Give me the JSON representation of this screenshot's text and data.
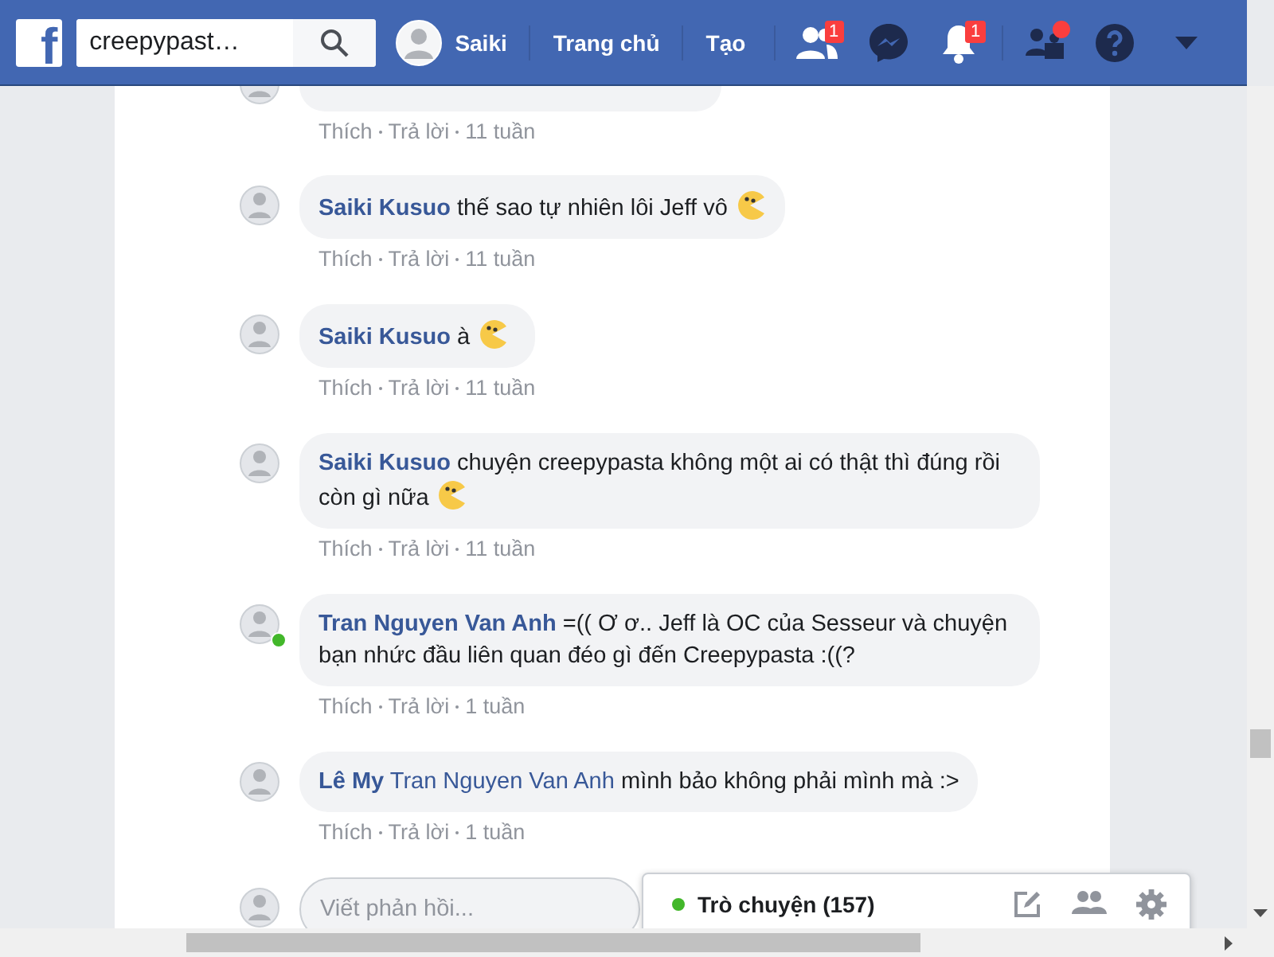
{
  "header": {
    "logo": "f",
    "search": {
      "value": "creepypast…"
    },
    "profile": {
      "name": "Saiki"
    },
    "nav": [
      "Trang chủ",
      "Tạo"
    ],
    "icons": [
      {
        "kind": "friends",
        "badge": "1"
      },
      {
        "kind": "messenger"
      },
      {
        "kind": "bell",
        "badge": "1"
      },
      {
        "kind": "people",
        "dot": true
      },
      {
        "kind": "help"
      },
      {
        "kind": "caret"
      }
    ]
  },
  "comments": [
    {
      "partial": true,
      "meta": {
        "like": "Thích",
        "reply": "Trả lời",
        "time": "11 tuần"
      }
    },
    {
      "author": "Saiki Kusuo",
      "text": "thế sao tự nhiên lôi Jeff vô",
      "emoji": true,
      "online": false,
      "meta": {
        "like": "Thích",
        "reply": "Trả lời",
        "time": "11 tuần"
      }
    },
    {
      "author": "Saiki Kusuo",
      "text": "à",
      "emoji": true,
      "online": false,
      "meta": {
        "like": "Thích",
        "reply": "Trả lời",
        "time": "11 tuần"
      }
    },
    {
      "author": "Saiki Kusuo",
      "text": "chuyện creepypasta không một ai có thật thì đúng rồi còn gì nữa",
      "emoji": true,
      "online": false,
      "meta": {
        "like": "Thích",
        "reply": "Trả lời",
        "time": "11 tuần"
      }
    },
    {
      "author": "Tran Nguyen Van Anh",
      "text": "=(( Ơ ơ.. Jeff là OC của Sesseur và chuyện bạn nhức đầu liên quan đéo gì đến Creepypasta :((?",
      "emoji": false,
      "online": true,
      "meta": {
        "like": "Thích",
        "reply": "Trả lời",
        "time": "1 tuần"
      }
    },
    {
      "author": "Lê My",
      "mention": "Tran Nguyen Van Anh",
      "text": "mình bảo không phải mình mà :>",
      "emoji": false,
      "online": false,
      "meta": {
        "like": "Thích",
        "reply": "Trả lời",
        "time": "1 tuần"
      }
    }
  ],
  "reply_field": {
    "placeholder": "Viết phản hồi..."
  },
  "chat": {
    "label": "Trò chuyện (157)",
    "online": true
  }
}
